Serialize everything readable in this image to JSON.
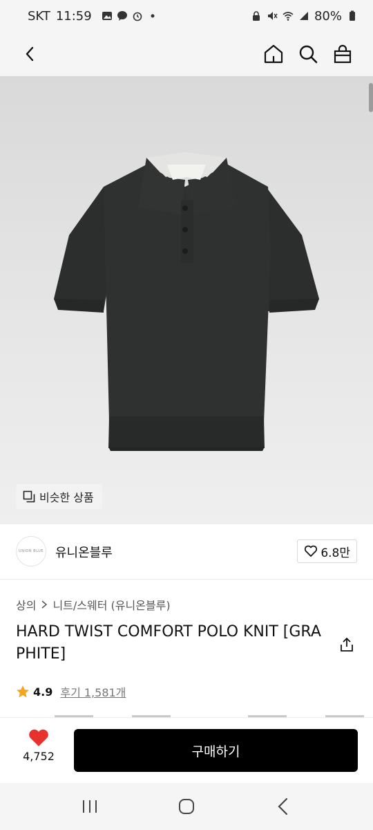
{
  "status_bar": {
    "carrier": "SKT",
    "time": "11:59",
    "battery": "80%",
    "left_icons": [
      "gallery-icon",
      "talk-icon",
      "alarm-icon",
      "dot-icon"
    ],
    "right_icons": [
      "lock-icon",
      "mute-icon",
      "wifi-icon",
      "signal-icon",
      "battery-icon"
    ]
  },
  "top_nav": {
    "back_icon": "chevron-left-icon",
    "right_icons": [
      "home-icon",
      "search-icon",
      "bag-icon"
    ]
  },
  "product_image": {
    "similar_button_label": "비슷한 상품",
    "similar_icon": "copy-icon",
    "tag_text": "UNION BLUE"
  },
  "brand": {
    "logo_text": "UNION BLUE",
    "name": "유니온블루",
    "like_count": "6.8만"
  },
  "breadcrumb": {
    "category": "상의",
    "subcategory": "니트/스웨터 (유니온블루)"
  },
  "product": {
    "title": "HARD TWIST COMFORT POLO KNIT [GRAPHITE]",
    "rating": "4.9",
    "review_label": "후기 1,581개"
  },
  "purchase_bar": {
    "heart_count": "4,752",
    "buy_label": "구매하기"
  },
  "android_nav": {
    "icons": [
      "recent-apps-icon",
      "home-circle-icon",
      "back-icon"
    ]
  },
  "colors": {
    "accent_heart": "#e8322e",
    "star": "#f4a620",
    "buy_button": "#000000",
    "knit": "#2b2e2d"
  }
}
